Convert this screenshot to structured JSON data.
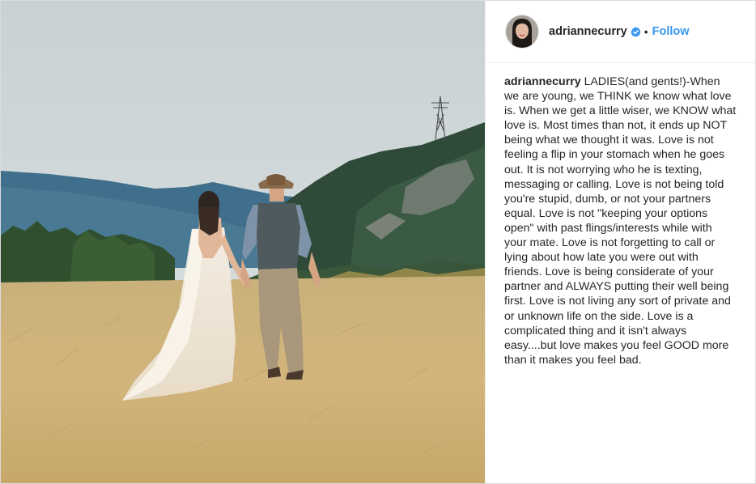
{
  "post": {
    "username": "adriannecurry",
    "follow_label": "Follow",
    "separator": "•",
    "caption_user": "adriannecurry",
    "caption_text": "LADIES(and gents!)-When we are young, we THINK we know what love is. When we get a little wiser, we KNOW what love is. Most times than not, it ends up NOT being what we thought it was. Love is not feeling a flip in your stomach when he goes out. It is not worrying who he is texting, messaging or calling. Love is not being told you're stupid, dumb, or not your partners equal. Love is not \"keeping your options open\" with past flings/interests while with your mate. Love is not forgetting to call or lying about how late you were out with friends. Love is being considerate of your partner and ALWAYS putting their well being first. Love is not living any sort of private and or unknown life on the side. Love is a complicated thing and it isn't always easy....but love makes you feel GOOD more than it makes you feel bad."
  },
  "icons": {
    "verified": "verified-badge-icon",
    "avatar": "profile-avatar"
  },
  "colors": {
    "follow": "#3897f0",
    "verified": "#3897f0",
    "text": "#262626",
    "border": "#dbdbdb"
  }
}
